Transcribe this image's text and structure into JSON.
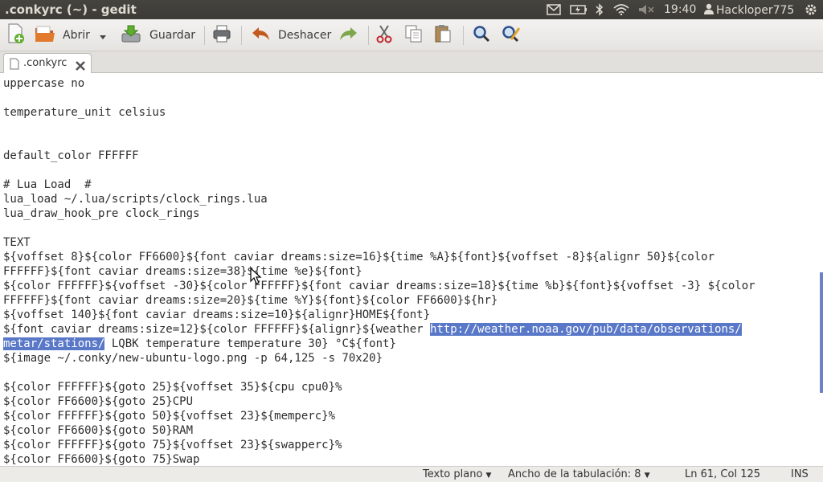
{
  "window": {
    "title": ".conkyrc (~) - gedit"
  },
  "panel": {
    "clock": "19:40",
    "user": "Hackloper775"
  },
  "toolbar": {
    "open_label": "Abrir",
    "save_label": "Guardar",
    "undo_label": "Deshacer"
  },
  "tab": {
    "label": ".conkyrc"
  },
  "editor": {
    "lines": [
      "uppercase no",
      "",
      "temperature_unit celsius",
      "",
      "",
      "default_color FFFFFF",
      "",
      "# Lua Load  #",
      "lua_load ~/.lua/scripts/clock_rings.lua",
      "lua_draw_hook_pre clock_rings",
      "",
      "TEXT",
      "${voffset 8}${color FF6600}${font caviar dreams:size=16}${time %A}${font}${voffset -8}${alignr 50}${color",
      "FFFFFF}${font caviar dreams:size=38}${time %e}${font}",
      "${color FFFFFF}${voffset -30}${color FFFFFF}${font caviar dreams:size=18}${time %b}${font}${voffset -3} ${color",
      "FFFFFF}${font caviar dreams:size=20}${time %Y}${font}${color FF6600}${hr}",
      "${voffset 140}${font caviar dreams:size=10}${alignr}HOME${font}",
      "${font caviar dreams:size=12}${color FFFFFF}${alignr}${weather ",
      "LQBK temperature temperature 30} °C${font}",
      "${image ~/.conky/new-ubuntu-logo.png -p 64,125 -s 70x20}",
      "",
      "${color FFFFFF}${goto 25}${voffset 35}${cpu cpu0}%",
      "${color FF6600}${goto 25}CPU",
      "${color FFFFFF}${goto 50}${voffset 23}${memperc}%",
      "${color FF6600}${goto 50}RAM",
      "${color FFFFFF}${goto 75}${voffset 23}${swapperc}%",
      "${color FF6600}${goto 75}Swap"
    ],
    "selection_part1": "http://weather.noaa.gov/pub/data/observations/",
    "selection_part2": "metar/stations/"
  },
  "status": {
    "syntax": "Texto plano",
    "tab_width": "Ancho de la tabulación:  8",
    "position": "Ln 61, Col 125",
    "mode": "INS"
  },
  "colors": {
    "selection": "#5a78c8",
    "panel": "#3c3b37",
    "accent": "#dd4814"
  }
}
